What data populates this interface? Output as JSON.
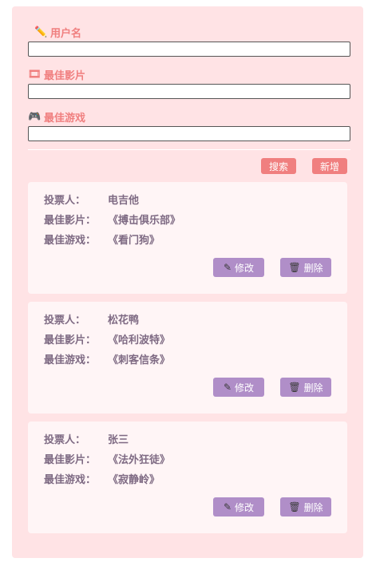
{
  "form": {
    "username": {
      "label": "用户名",
      "icon": "pencil-icon",
      "value": ""
    },
    "movie": {
      "label": "最佳影片",
      "icon": "film-icon",
      "value": ""
    },
    "game": {
      "label": "最佳游戏",
      "icon": "gamepad-icon",
      "value": ""
    }
  },
  "toolbar": {
    "search_label": "搜索",
    "add_label": "新增"
  },
  "card_labels": {
    "voter": "投票人：",
    "movie": "最佳影片：",
    "game": "最佳游戏："
  },
  "actions": {
    "edit_label": "修改",
    "delete_label": "删除"
  },
  "votes": [
    {
      "voter": "电吉他",
      "movie": "《搏击俱乐部》",
      "game": "《看门狗》"
    },
    {
      "voter": "松花鸭",
      "movie": "《哈利波特》",
      "game": "《刺客信条》"
    },
    {
      "voter": "张三",
      "movie": "《法外狂徒》",
      "game": "《寂静岭》"
    }
  ],
  "colors": {
    "panel": "#ffe3e5",
    "accent": "#f07f7f",
    "button": "#b08ec8",
    "text": "#7e6a83"
  }
}
